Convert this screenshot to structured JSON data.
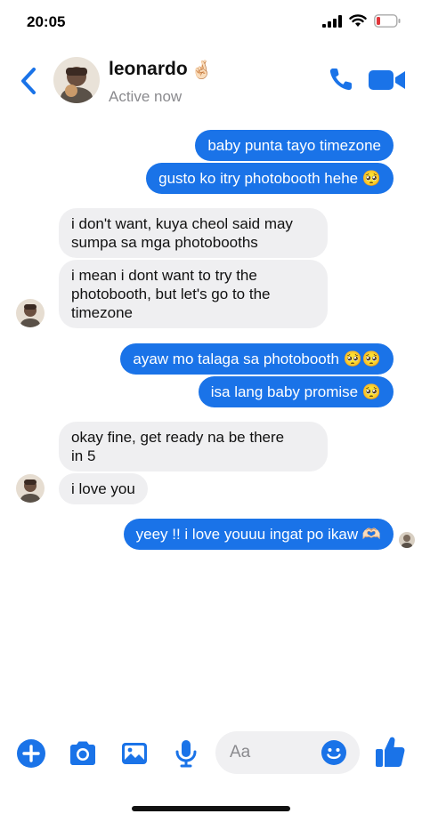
{
  "status_bar": {
    "time": "20:05"
  },
  "header": {
    "name": "leonardo",
    "name_emoji": "🤞🏻",
    "status": "Active now"
  },
  "messages": [
    {
      "side": "out",
      "text": "baby punta tayo timezone"
    },
    {
      "side": "out",
      "text": "gusto ko itry photobooth hehe 🥺"
    },
    {
      "side": "in",
      "lines": [
        "i don't want, kuya cheol said may",
        "sumpa sa mga photobooths"
      ]
    },
    {
      "side": "in",
      "lines": [
        "i mean i dont want to try the",
        "photobooth, but let's go to the",
        "timezone"
      ]
    },
    {
      "side": "out",
      "text": "ayaw mo talaga sa photobooth 🥺🥺"
    },
    {
      "side": "out",
      "text": "isa lang baby promise 🥺"
    },
    {
      "side": "in",
      "lines": [
        "okay fine, get ready na be there",
        "in 5"
      ]
    },
    {
      "side": "in",
      "text": "i love you"
    },
    {
      "side": "out",
      "text": "yeey !! i love youuu ingat po ikaw 🫶🏻"
    }
  ],
  "composer": {
    "placeholder": "Aa"
  },
  "colors": {
    "accent": "#1a73e8",
    "incoming_bubble": "#efeff1"
  }
}
